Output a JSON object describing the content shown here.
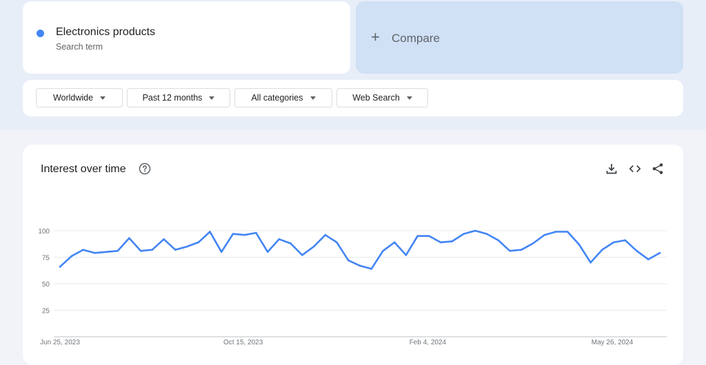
{
  "search_term": {
    "name": "Electronics products",
    "sublabel": "Search term",
    "color": "#4285f4"
  },
  "compare": {
    "plus": "+",
    "label": "Compare"
  },
  "filters": [
    {
      "label": "Worldwide"
    },
    {
      "label": "Past 12 months"
    },
    {
      "label": "All categories"
    },
    {
      "label": "Web Search"
    }
  ],
  "chart_panel": {
    "title": "Interest over time",
    "icons": [
      "help-icon",
      "download-icon",
      "embed-code-icon",
      "share-icon"
    ]
  },
  "chart_data": {
    "type": "line",
    "ylim": [
      0,
      100
    ],
    "yticks": [
      25,
      50,
      75,
      100
    ],
    "x_tick_labels": [
      "Jun 25, 2023",
      "Oct 15, 2023",
      "Feb 4, 2024",
      "May 26, 2024"
    ],
    "x_tick_indices": [
      0,
      16,
      32,
      48
    ],
    "series": [
      {
        "color": "#4285f4",
        "values": [
          66,
          76,
          82,
          79,
          80,
          81,
          93,
          81,
          82,
          92,
          82,
          85,
          89,
          99,
          80,
          97,
          96,
          98,
          80,
          92,
          88,
          77,
          85,
          96,
          89,
          72,
          67,
          64,
          81,
          89,
          77,
          95,
          95,
          89,
          90,
          97,
          100,
          97,
          91,
          81,
          82,
          88,
          96,
          99,
          99,
          87,
          70,
          82,
          89,
          91,
          81,
          73,
          79
        ]
      }
    ]
  }
}
